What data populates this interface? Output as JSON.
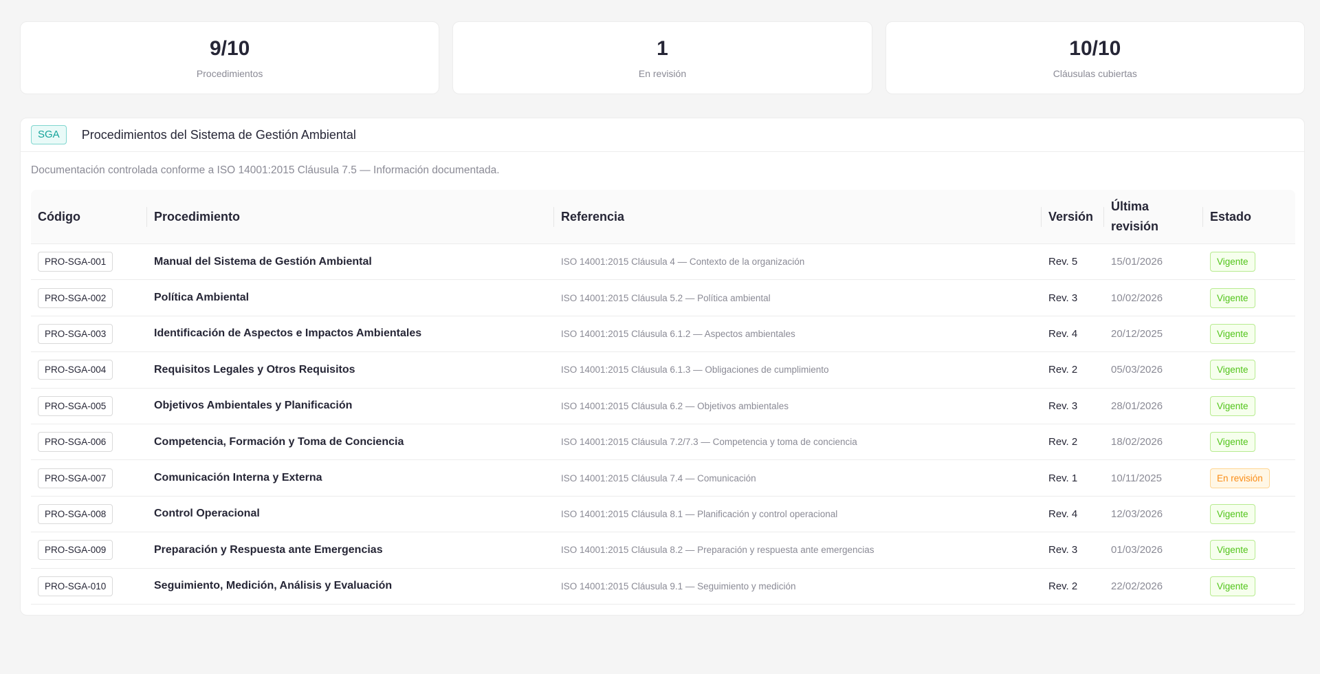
{
  "stats": [
    {
      "value": "9/10",
      "label": "Procedimientos"
    },
    {
      "value": "1",
      "label": "En revisión"
    },
    {
      "value": "10/10",
      "label": "Cláusulas cubiertas"
    }
  ],
  "panel": {
    "tag": "SGA",
    "title": "Procedimientos del Sistema de Gestión Ambiental",
    "description": "Documentación controlada conforme a ISO 14001:2015 Cláusula 7.5 — Información documentada."
  },
  "table": {
    "headers": [
      "Código",
      "Procedimiento",
      "Referencia",
      "Versión",
      "Última revisión",
      "Estado"
    ],
    "rows": [
      {
        "code": "PRO-SGA-001",
        "name": "Manual del Sistema de Gestión Ambiental",
        "ref": "ISO 14001:2015 Cláusula 4 — Contexto de la organización",
        "version": "Rev. 5",
        "date": "15/01/2026",
        "status": "Vigente",
        "status_type": "ok"
      },
      {
        "code": "PRO-SGA-002",
        "name": "Política Ambiental",
        "ref": "ISO 14001:2015 Cláusula 5.2 — Política ambiental",
        "version": "Rev. 3",
        "date": "10/02/2026",
        "status": "Vigente",
        "status_type": "ok"
      },
      {
        "code": "PRO-SGA-003",
        "name": "Identificación de Aspectos e Impactos Ambientales",
        "ref": "ISO 14001:2015 Cláusula 6.1.2 — Aspectos ambientales",
        "version": "Rev. 4",
        "date": "20/12/2025",
        "status": "Vigente",
        "status_type": "ok"
      },
      {
        "code": "PRO-SGA-004",
        "name": "Requisitos Legales y Otros Requisitos",
        "ref": "ISO 14001:2015 Cláusula 6.1.3 — Obligaciones de cumplimiento",
        "version": "Rev. 2",
        "date": "05/03/2026",
        "status": "Vigente",
        "status_type": "ok"
      },
      {
        "code": "PRO-SGA-005",
        "name": "Objetivos Ambientales y Planificación",
        "ref": "ISO 14001:2015 Cláusula 6.2 — Objetivos ambientales",
        "version": "Rev. 3",
        "date": "28/01/2026",
        "status": "Vigente",
        "status_type": "ok"
      },
      {
        "code": "PRO-SGA-006",
        "name": "Competencia, Formación y Toma de Conciencia",
        "ref": "ISO 14001:2015 Cláusula 7.2/7.3 — Competencia y toma de conciencia",
        "version": "Rev. 2",
        "date": "18/02/2026",
        "status": "Vigente",
        "status_type": "ok"
      },
      {
        "code": "PRO-SGA-007",
        "name": "Comunicación Interna y Externa",
        "ref": "ISO 14001:2015 Cláusula 7.4 — Comunicación",
        "version": "Rev. 1",
        "date": "10/11/2025",
        "status": "En revisión",
        "status_type": "rev"
      },
      {
        "code": "PRO-SGA-008",
        "name": "Control Operacional",
        "ref": "ISO 14001:2015 Cláusula 8.1 — Planificación y control operacional",
        "version": "Rev. 4",
        "date": "12/03/2026",
        "status": "Vigente",
        "status_type": "ok"
      },
      {
        "code": "PRO-SGA-009",
        "name": "Preparación y Respuesta ante Emergencias",
        "ref": "ISO 14001:2015 Cláusula 8.2 — Preparación y respuesta ante emergencias",
        "version": "Rev. 3",
        "date": "01/03/2026",
        "status": "Vigente",
        "status_type": "ok"
      },
      {
        "code": "PRO-SGA-010",
        "name": "Seguimiento, Medición, Análisis y Evaluación",
        "ref": "ISO 14001:2015 Cláusula 9.1 — Seguimiento y medición",
        "version": "Rev. 2",
        "date": "22/02/2026",
        "status": "Vigente",
        "status_type": "ok"
      }
    ]
  }
}
